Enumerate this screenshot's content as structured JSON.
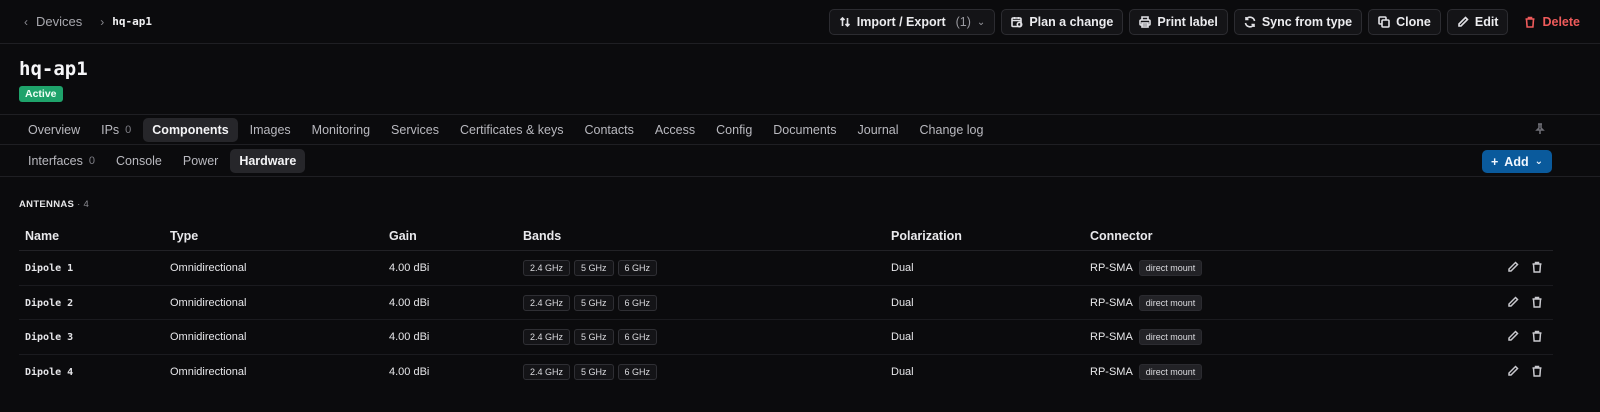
{
  "breadcrumb": {
    "parent": "Devices",
    "current": "hq-ap1"
  },
  "actions": {
    "import_export": "Import / Export",
    "import_export_count": "(1)",
    "plan_change": "Plan a change",
    "print_label": "Print label",
    "sync_from_type": "Sync from type",
    "clone": "Clone",
    "edit": "Edit",
    "delete": "Delete"
  },
  "device": {
    "name": "hq-ap1",
    "status": "Active"
  },
  "tabs": [
    {
      "label": "Overview"
    },
    {
      "label": "IPs",
      "count": "0"
    },
    {
      "label": "Components",
      "active": true
    },
    {
      "label": "Images"
    },
    {
      "label": "Monitoring"
    },
    {
      "label": "Services"
    },
    {
      "label": "Certificates & keys"
    },
    {
      "label": "Contacts"
    },
    {
      "label": "Access"
    },
    {
      "label": "Config"
    },
    {
      "label": "Documents"
    },
    {
      "label": "Journal"
    },
    {
      "label": "Change log"
    }
  ],
  "subtabs": [
    {
      "label": "Interfaces",
      "count": "0"
    },
    {
      "label": "Console"
    },
    {
      "label": "Power"
    },
    {
      "label": "Hardware",
      "active": true
    }
  ],
  "add_label": "Add",
  "section": {
    "title": "ANTENNAS",
    "count": "· 4"
  },
  "table": {
    "columns": [
      "Name",
      "Type",
      "Gain",
      "Bands",
      "Polarization",
      "Connector"
    ],
    "rows": [
      {
        "name": "Dipole 1",
        "type": "Omnidirectional",
        "gain": "4.00 dBi",
        "bands": [
          "2.4 GHz",
          "5 GHz",
          "6 GHz"
        ],
        "polarization": "Dual",
        "connector": "RP-SMA",
        "mount": "direct mount"
      },
      {
        "name": "Dipole 2",
        "type": "Omnidirectional",
        "gain": "4.00 dBi",
        "bands": [
          "2.4 GHz",
          "5 GHz",
          "6 GHz"
        ],
        "polarization": "Dual",
        "connector": "RP-SMA",
        "mount": "direct mount"
      },
      {
        "name": "Dipole 3",
        "type": "Omnidirectional",
        "gain": "4.00 dBi",
        "bands": [
          "2.4 GHz",
          "5 GHz",
          "6 GHz"
        ],
        "polarization": "Dual",
        "connector": "RP-SMA",
        "mount": "direct mount"
      },
      {
        "name": "Dipole 4",
        "type": "Omnidirectional",
        "gain": "4.00 dBi",
        "bands": [
          "2.4 GHz",
          "5 GHz",
          "6 GHz"
        ],
        "polarization": "Dual",
        "connector": "RP-SMA",
        "mount": "direct mount"
      }
    ]
  },
  "icons": {
    "back": "chevron-left-icon",
    "separator": "chevron-right-icon",
    "import_export": "arrows-up-down-icon",
    "plan": "calendar-clock-icon",
    "print": "printer-icon",
    "sync": "refresh-icon",
    "clone": "copy-icon",
    "edit": "pencil-icon",
    "delete": "trash-icon",
    "pin": "pin-icon",
    "add": "plus-icon"
  },
  "colors": {
    "accent": "#0a5a9c",
    "active": "#1fa36b",
    "danger": "#ef5b5b"
  }
}
